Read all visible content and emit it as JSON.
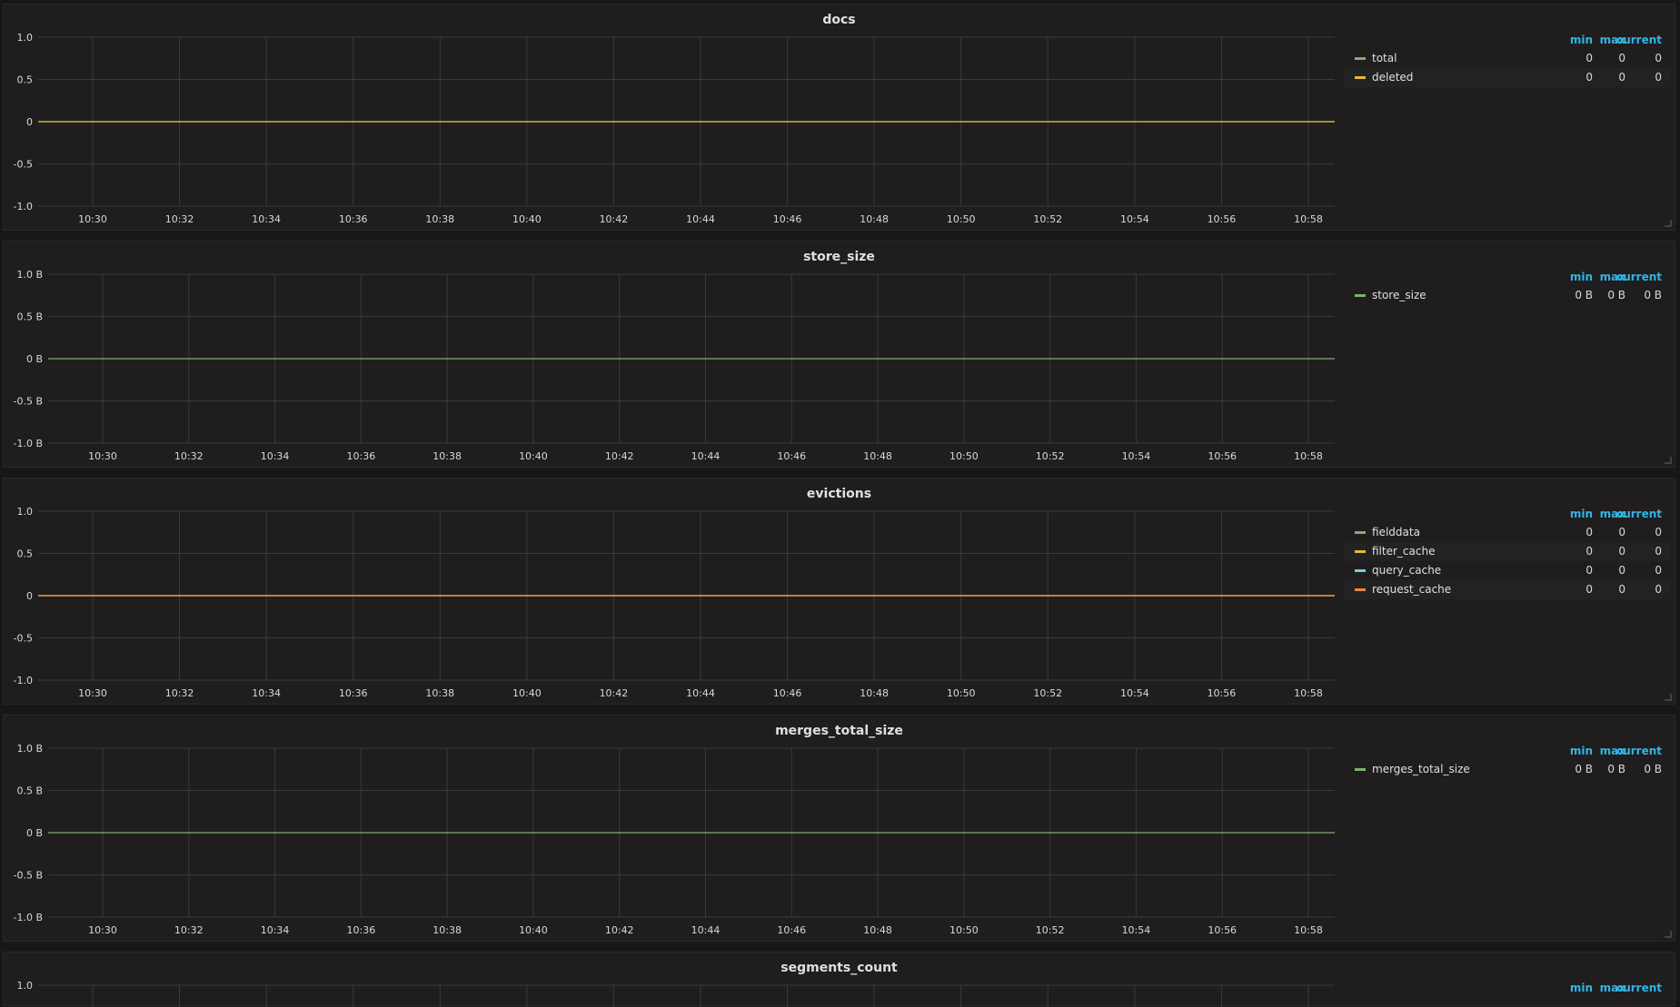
{
  "columns": {
    "min": "min",
    "max": "max",
    "current": "current"
  },
  "x_ticks": [
    "10:30",
    "10:32",
    "10:34",
    "10:36",
    "10:38",
    "10:40",
    "10:42",
    "10:44",
    "10:46",
    "10:48",
    "10:50",
    "10:52",
    "10:54",
    "10:56",
    "10:58"
  ],
  "panels": [
    {
      "title": "docs",
      "y_ticks": [
        "1.0",
        "0.5",
        "0",
        "-0.5",
        "-1.0"
      ],
      "series": [
        {
          "name": "total",
          "color": "#7eb26d",
          "min": "0",
          "max": "0",
          "current": "0"
        },
        {
          "name": "deleted",
          "color": "#eab839",
          "min": "0",
          "max": "0",
          "current": "0"
        }
      ],
      "line_color": "#eab839"
    },
    {
      "title": "store_size",
      "y_ticks": [
        "1.0 B",
        "0.5 B",
        "0 B",
        "-0.5 B",
        "-1.0 B"
      ],
      "series": [
        {
          "name": "store_size",
          "color": "#7eb26d",
          "min": "0 B",
          "max": "0 B",
          "current": "0 B"
        }
      ],
      "line_color": "#7eb26d"
    },
    {
      "title": "evictions",
      "y_ticks": [
        "1.0",
        "0.5",
        "0",
        "-0.5",
        "-1.0"
      ],
      "series": [
        {
          "name": "fielddata",
          "color": "#7eb26d",
          "min": "0",
          "max": "0",
          "current": "0"
        },
        {
          "name": "filter_cache",
          "color": "#eab839",
          "min": "0",
          "max": "0",
          "current": "0"
        },
        {
          "name": "query_cache",
          "color": "#6ed0e0",
          "min": "0",
          "max": "0",
          "current": "0"
        },
        {
          "name": "request_cache",
          "color": "#ef843c",
          "min": "0",
          "max": "0",
          "current": "0"
        }
      ],
      "line_color": "#ef843c"
    },
    {
      "title": "merges_total_size",
      "y_ticks": [
        "1.0 B",
        "0.5 B",
        "0 B",
        "-0.5 B",
        "-1.0 B"
      ],
      "series": [
        {
          "name": "merges_total_size",
          "color": "#7eb26d",
          "min": "0 B",
          "max": "0 B",
          "current": "0 B"
        }
      ],
      "line_color": "#7eb26d"
    },
    {
      "title": "segments_count",
      "y_ticks": [
        "1.0"
      ],
      "series": [],
      "line_color": "#7eb26d"
    }
  ],
  "chart_data": [
    {
      "type": "line",
      "title": "docs",
      "categories": [
        "10:30",
        "10:32",
        "10:34",
        "10:36",
        "10:38",
        "10:40",
        "10:42",
        "10:44",
        "10:46",
        "10:48",
        "10:50",
        "10:52",
        "10:54",
        "10:56",
        "10:58"
      ],
      "series": [
        {
          "name": "total",
          "values": [
            0,
            0,
            0,
            0,
            0,
            0,
            0,
            0,
            0,
            0,
            0,
            0,
            0,
            0,
            0
          ]
        },
        {
          "name": "deleted",
          "values": [
            0,
            0,
            0,
            0,
            0,
            0,
            0,
            0,
            0,
            0,
            0,
            0,
            0,
            0,
            0
          ]
        }
      ],
      "ylim": [
        -1,
        1
      ],
      "grid": true,
      "legend": "right"
    },
    {
      "type": "line",
      "title": "store_size",
      "categories": [
        "10:30",
        "10:32",
        "10:34",
        "10:36",
        "10:38",
        "10:40",
        "10:42",
        "10:44",
        "10:46",
        "10:48",
        "10:50",
        "10:52",
        "10:54",
        "10:56",
        "10:58"
      ],
      "series": [
        {
          "name": "store_size",
          "values": [
            0,
            0,
            0,
            0,
            0,
            0,
            0,
            0,
            0,
            0,
            0,
            0,
            0,
            0,
            0
          ]
        }
      ],
      "ylim": [
        -1,
        1
      ],
      "grid": true,
      "legend": "right"
    },
    {
      "type": "line",
      "title": "evictions",
      "categories": [
        "10:30",
        "10:32",
        "10:34",
        "10:36",
        "10:38",
        "10:40",
        "10:42",
        "10:44",
        "10:46",
        "10:48",
        "10:50",
        "10:52",
        "10:54",
        "10:56",
        "10:58"
      ],
      "series": [
        {
          "name": "fielddata",
          "values": [
            0,
            0,
            0,
            0,
            0,
            0,
            0,
            0,
            0,
            0,
            0,
            0,
            0,
            0,
            0
          ]
        },
        {
          "name": "filter_cache",
          "values": [
            0,
            0,
            0,
            0,
            0,
            0,
            0,
            0,
            0,
            0,
            0,
            0,
            0,
            0,
            0
          ]
        },
        {
          "name": "query_cache",
          "values": [
            0,
            0,
            0,
            0,
            0,
            0,
            0,
            0,
            0,
            0,
            0,
            0,
            0,
            0,
            0
          ]
        },
        {
          "name": "request_cache",
          "values": [
            0,
            0,
            0,
            0,
            0,
            0,
            0,
            0,
            0,
            0,
            0,
            0,
            0,
            0,
            0
          ]
        }
      ],
      "ylim": [
        -1,
        1
      ],
      "grid": true,
      "legend": "right"
    },
    {
      "type": "line",
      "title": "merges_total_size",
      "categories": [
        "10:30",
        "10:32",
        "10:34",
        "10:36",
        "10:38",
        "10:40",
        "10:42",
        "10:44",
        "10:46",
        "10:48",
        "10:50",
        "10:52",
        "10:54",
        "10:56",
        "10:58"
      ],
      "series": [
        {
          "name": "merges_total_size",
          "values": [
            0,
            0,
            0,
            0,
            0,
            0,
            0,
            0,
            0,
            0,
            0,
            0,
            0,
            0,
            0
          ]
        }
      ],
      "ylim": [
        -1,
        1
      ],
      "grid": true,
      "legend": "right"
    },
    {
      "type": "line",
      "title": "segments_count",
      "categories": [],
      "series": [],
      "grid": true,
      "legend": "right"
    }
  ]
}
